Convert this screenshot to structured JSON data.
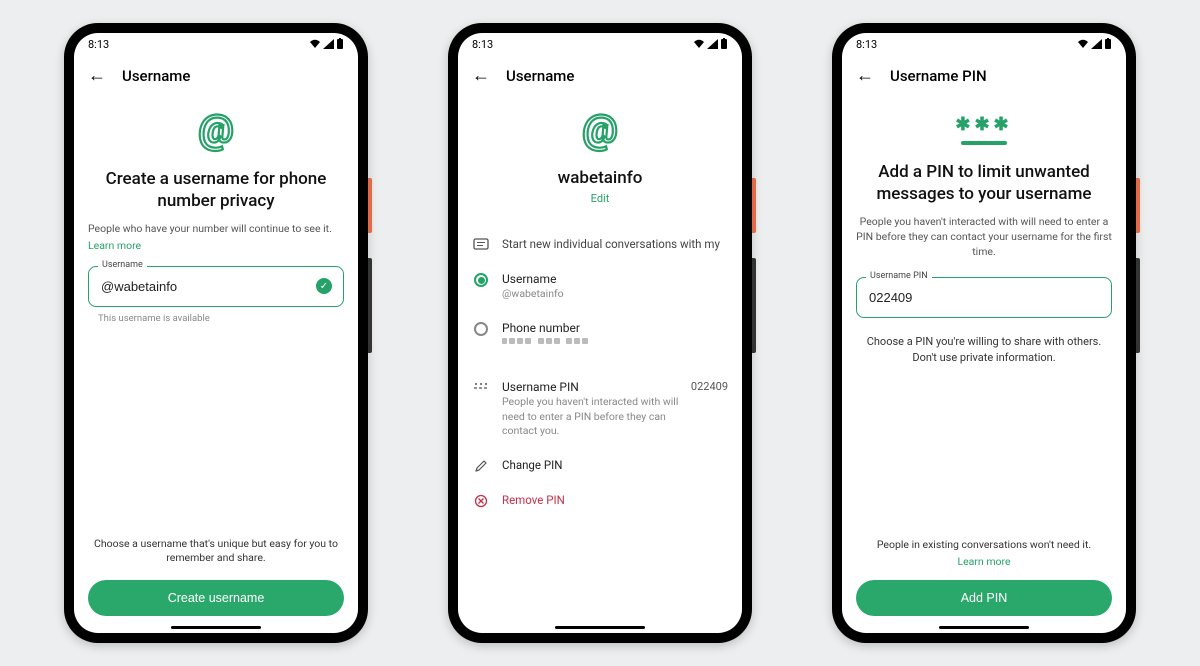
{
  "status": {
    "time": "8:13"
  },
  "screen1": {
    "header": "Username",
    "title": "Create a username for phone number privacy",
    "sub": "People who have your number will continue to see it.",
    "learn_more": "Learn more",
    "input_label": "Username",
    "input_value": "@wabetainfo",
    "helper": "This username is available",
    "bottom_info": "Choose a username that's unique but easy for you to remember and share.",
    "button": "Create username"
  },
  "screen2": {
    "header": "Username",
    "username": "wabetainfo",
    "edit": "Edit",
    "start_convo": "Start new individual conversations with my",
    "opt_username": {
      "label": "Username",
      "handle": "@wabetainfo"
    },
    "opt_phone": {
      "label": "Phone number"
    },
    "pin_section": {
      "title": "Username PIN",
      "desc": "People you haven't interacted with will need to enter a PIN before they can contact you.",
      "value": "022409"
    },
    "change_pin": "Change PIN",
    "remove_pin": "Remove PIN"
  },
  "screen3": {
    "header": "Username PIN",
    "title": "Add a PIN to limit unwanted messages to your username",
    "sub": "People you haven't interacted with will need to enter a PIN before they can contact your username for the first time.",
    "input_label": "Username PIN",
    "input_value": "022409",
    "info": "Choose a PIN you're willing to share with others. Don't use private information.",
    "bottom_info": "People in existing conversations won't need it.",
    "learn_more": "Learn more",
    "button": "Add PIN"
  }
}
